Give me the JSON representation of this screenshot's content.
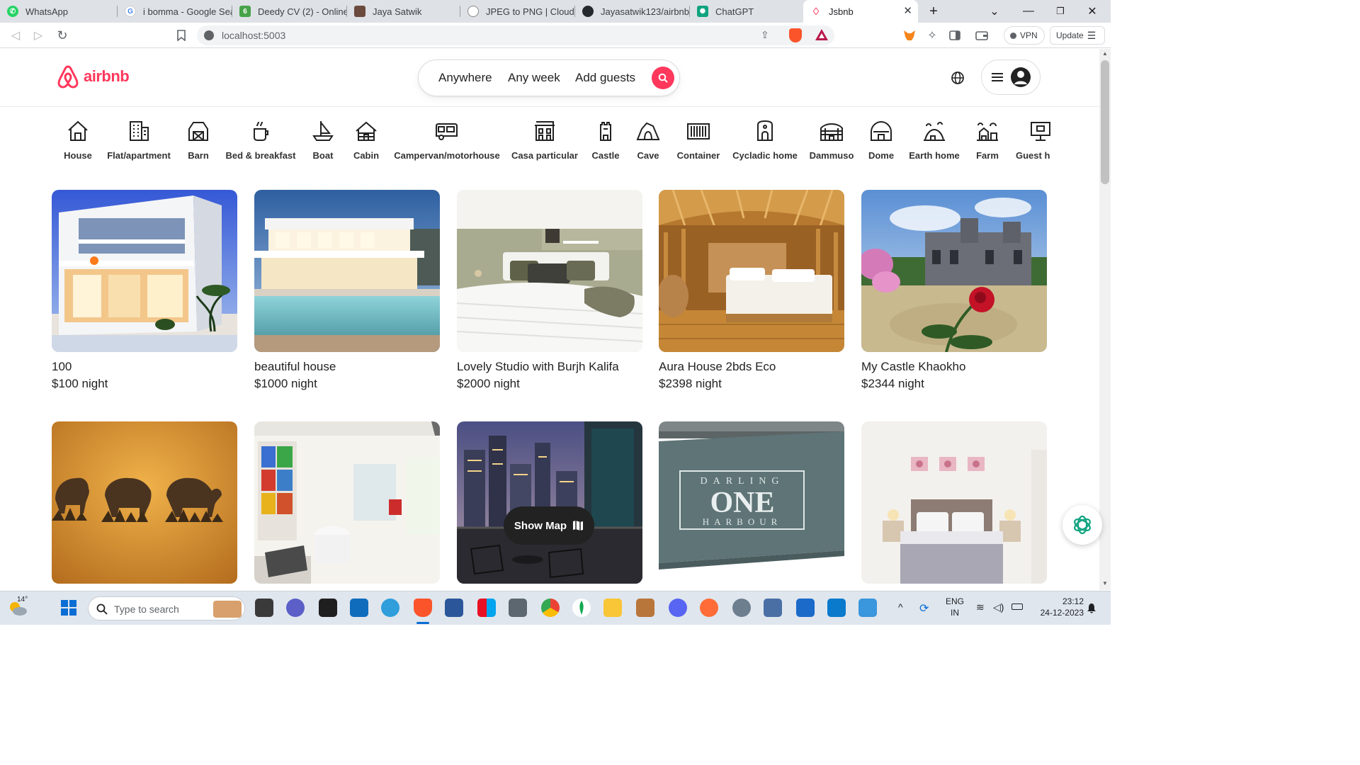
{
  "browser": {
    "tabs": [
      {
        "title": "WhatsApp",
        "color": "#25d366"
      },
      {
        "title": "i bomma - Google Sea",
        "color": "#4285f4"
      },
      {
        "title": "Deedy CV (2) - Online",
        "color": "#47a248"
      },
      {
        "title": "Jaya Satwik",
        "color": "#6b4b3e"
      },
      {
        "title": "JPEG to PNG | CloudCo",
        "color": "#888888"
      },
      {
        "title": "Jayasatwik123/airbnb",
        "color": "#24292e"
      },
      {
        "title": "ChatGPT",
        "color": "#10a37f"
      },
      {
        "title": "Jsbnb",
        "color": "#ff385c"
      }
    ],
    "url": "localhost:5003",
    "vpn_label": "VPN",
    "update_label": "Update"
  },
  "airbnb": {
    "logo": "airbnb",
    "search": {
      "location": "Anywhere",
      "week": "Any week",
      "guests": "Add guests"
    },
    "categories": [
      "House",
      "Flat/apartment",
      "Barn",
      "Bed & breakfast",
      "Boat",
      "Cabin",
      "Campervan/motorhouse",
      "Casa particular",
      "Castle",
      "Cave",
      "Container",
      "Cycladic home",
      "Dammuso",
      "Dome",
      "Earth home",
      "Farm",
      "Guest h"
    ],
    "listings": [
      {
        "title": "100",
        "price": "$100 night"
      },
      {
        "title": "beautiful house",
        "price": "$1000 night"
      },
      {
        "title": "Lovely Studio with Burjh Kalifa",
        "price": "$2000 night"
      },
      {
        "title": "Aura House 2bds Eco",
        "price": "$2398 night"
      },
      {
        "title": "My Castle Khaokho",
        "price": "$2344 night"
      }
    ],
    "sign_text": {
      "top": "DARLING",
      "middle": "ONE",
      "bottom": "HARBOUR"
    },
    "show_map": "Show Map",
    "brand_color": "#ff385c"
  },
  "taskbar": {
    "weather": "14°",
    "search_placeholder": "Type to search",
    "lang_top": "ENG",
    "lang_bottom": "IN",
    "time": "23:12",
    "date": "24-12-2023"
  }
}
